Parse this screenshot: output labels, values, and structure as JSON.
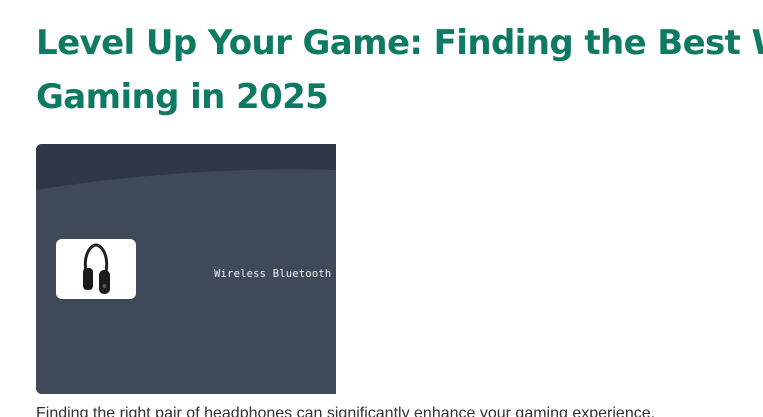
{
  "article": {
    "title_line1": "Level Up Your Game: Finding the Best Wi",
    "title_line2": "Gaming in 2025",
    "hero": {
      "label": "Wireless Bluetooth",
      "thumbnail_icon": "headphones-icon"
    },
    "intro_text": "Finding the right pair of headphones can significantly enhance your gaming experience."
  },
  "colors": {
    "title": "#0f7a63",
    "hero_background": "#3f4a58",
    "hero_top_band": "#2f3846"
  }
}
